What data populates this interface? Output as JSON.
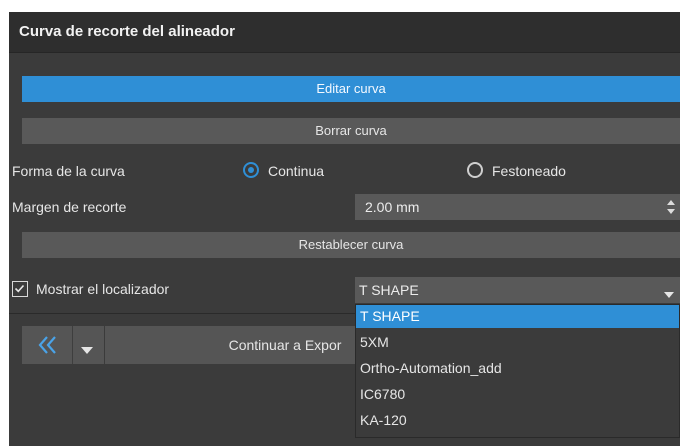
{
  "panel": {
    "title": "Curva de recorte del alineador"
  },
  "buttons": {
    "edit_curve": "Editar curva",
    "delete_curve": "Borrar curva",
    "reset_curve": "Restablecer curva",
    "continue_export": "Continuar a Expor"
  },
  "curve_shape": {
    "label": "Forma de la curva",
    "options": [
      {
        "label": "Continua",
        "checked": true
      },
      {
        "label": "Festoneado",
        "checked": false
      }
    ]
  },
  "trim_margin": {
    "label": "Margen de recorte",
    "value": "2.00 mm"
  },
  "locator": {
    "label": "Mostrar el localizador",
    "checked": true,
    "selected": "T SHAPE",
    "options": [
      "T SHAPE",
      "5XM",
      "Ortho-Automation_add",
      "IC6780",
      "KA-120"
    ]
  },
  "icons": {
    "back": "double-chevron-left-icon",
    "back_menu": "caret-down-icon",
    "spin": "spin-arrows-icon",
    "dropdown": "caret-down-icon",
    "check": "checkmark-icon"
  },
  "colors": {
    "accent": "#2f8fd6",
    "panel_bg": "#3b3b3b",
    "header_bg": "#2e2e2e",
    "button_bg": "#595959"
  }
}
